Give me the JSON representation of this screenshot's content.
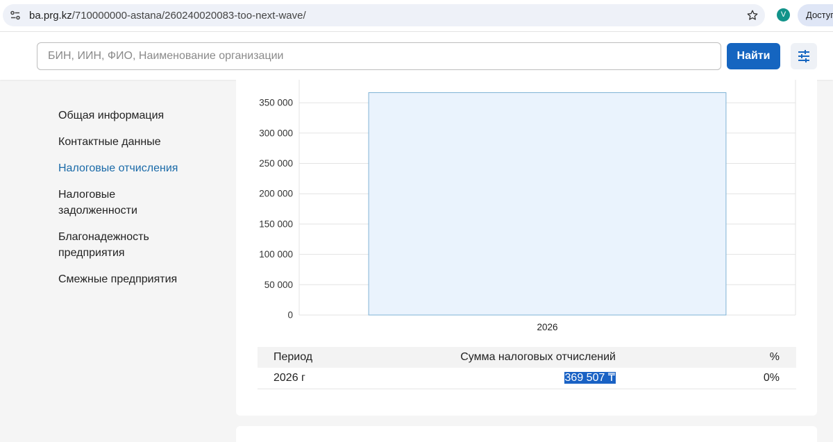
{
  "browser": {
    "url_host": "ba.prg.kz",
    "url_path": "/710000000-astana/260240020083-too-next-wave/",
    "avatar_letter": "V",
    "access_label": "Доступно"
  },
  "header": {
    "search_placeholder": "БИН, ИИН, ФИО, Наименование организации",
    "search_button": "Найти",
    "filter_icon": "sliders-icon"
  },
  "sidebar": {
    "items": [
      {
        "label": "Общая информация",
        "active": false
      },
      {
        "label": "Контактные данные",
        "active": false
      },
      {
        "label": "Налоговые отчисления",
        "active": true
      },
      {
        "label": "Налоговые задолженности",
        "active": false
      },
      {
        "label": "Благонадежность предприятия",
        "active": false
      },
      {
        "label": "Смежные предприятия",
        "active": false
      }
    ]
  },
  "chart_data": {
    "type": "bar",
    "categories": [
      "2026"
    ],
    "values": [
      369507
    ],
    "ylim": [
      0,
      350000
    ],
    "yticks": [
      0,
      50000,
      100000,
      150000,
      200000,
      250000,
      300000,
      350000
    ],
    "ytick_labels": [
      "0",
      "50 000",
      "100 000",
      "150 000",
      "200 000",
      "250 000",
      "300 000",
      "350 000"
    ],
    "grid": true,
    "bar_fill": "#eaf3fd",
    "bar_stroke": "#7fb3d5"
  },
  "table": {
    "headers": {
      "period": "Период",
      "sum": "Сумма налоговых отчислений",
      "pct": "%"
    },
    "rows": [
      {
        "period": "2026 г",
        "sum": "369 507 ₸",
        "pct": "0%"
      }
    ]
  },
  "colors": {
    "primary": "#1565c0",
    "active_link": "#1a6aa8",
    "selection": "#1a62c4"
  }
}
